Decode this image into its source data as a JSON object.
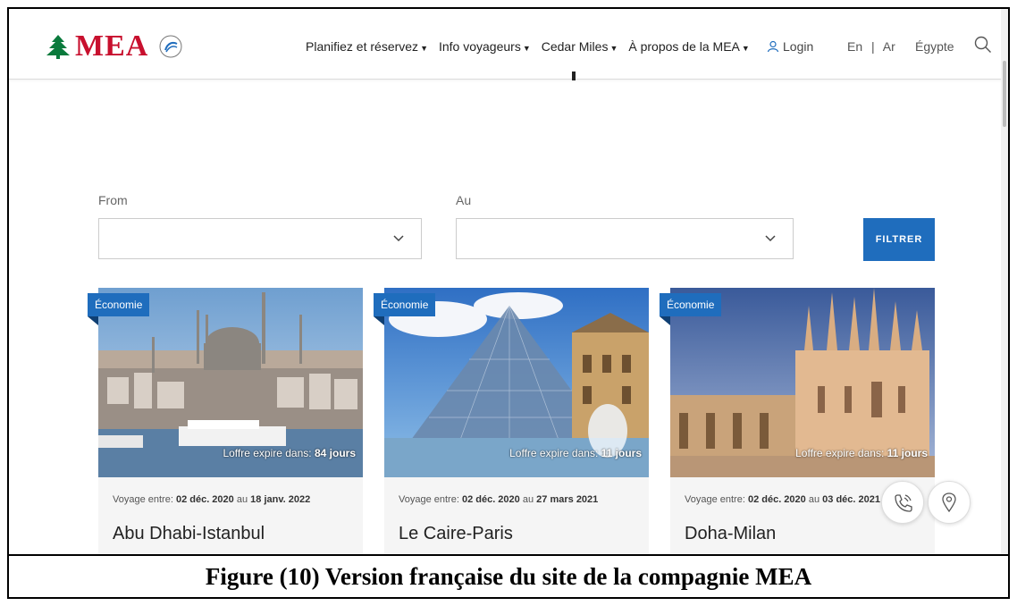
{
  "header": {
    "logo_text": "MEA",
    "nav": [
      {
        "label": "Planifiez et réservez"
      },
      {
        "label": "Info voyageurs"
      },
      {
        "label": "Cedar Miles"
      },
      {
        "label": "À propos de la MEA"
      }
    ],
    "login_label": "Login",
    "lang": {
      "en": "En",
      "sep": "|",
      "ar": "Ar"
    },
    "country": "Égypte"
  },
  "filter": {
    "from_label": "From",
    "to_label": "Au",
    "from_value": "",
    "to_value": "",
    "button_label": "FILTRER"
  },
  "offers": [
    {
      "badge": "Économie",
      "expire_prefix": "Loffre expire dans:",
      "expire_days": "84 jours",
      "dates_prefix": "Voyage entre:",
      "date_from": "02 déc. 2020",
      "dates_mid": "au",
      "date_to": "18 janv. 2022",
      "route": "Abu Dhabi-Istanbul",
      "image": "istanbul-mosque-skyline"
    },
    {
      "badge": "Économie",
      "expire_prefix": "Loffre expire dans:",
      "expire_days": "11 jours",
      "dates_prefix": "Voyage entre:",
      "date_from": "02 déc. 2020",
      "dates_mid": "au",
      "date_to": "27 mars 2021",
      "route": "Le Caire-Paris",
      "image": "louvre-pyramid"
    },
    {
      "badge": "Économie",
      "expire_prefix": "Loffre expire dans:",
      "expire_days": "11 jours",
      "dates_prefix": "Voyage entre:",
      "date_from": "02 déc. 2020",
      "dates_mid": "au",
      "date_to": "03 déc. 2021",
      "route": "Doha-Milan",
      "image": "milan-cathedral"
    }
  ],
  "fabs": {
    "phone_icon": "phone-icon",
    "location_icon": "location-pin-icon"
  },
  "caption": "Figure (10) Version française du site de la compagnie MEA",
  "colors": {
    "brand_red": "#c8102e",
    "brand_green": "#0a7a3c",
    "accent_blue": "#1f6dbd"
  }
}
